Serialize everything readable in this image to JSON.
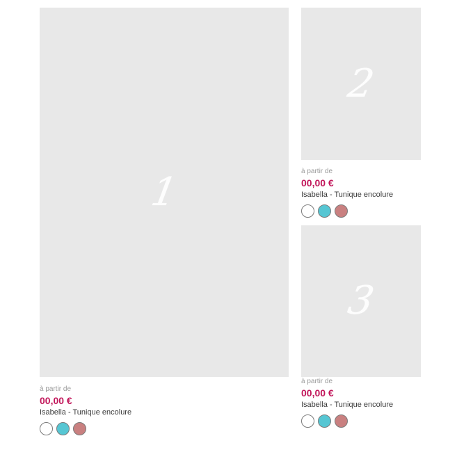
{
  "products": [
    {
      "number": "1",
      "price_prefix": "à partir de",
      "price": "00,00 €",
      "name": "Isabella - Tunique encolure",
      "swatches": [
        "#ffffff",
        "#56c6d3",
        "#c98080"
      ]
    },
    {
      "number": "2",
      "price_prefix": "à partir de",
      "price": "00,00 €",
      "name": "Isabella - Tunique encolure",
      "swatches": [
        "#ffffff",
        "#56c6d3",
        "#c98080"
      ]
    },
    {
      "number": "3",
      "price_prefix": "à partir de",
      "price": "00,00 €",
      "name": "Isabella - Tunique encolure",
      "swatches": [
        "#ffffff",
        "#56c6d3",
        "#c98080"
      ]
    }
  ],
  "colors": {
    "price": "#c2185b",
    "placeholder": "#e8e8e8"
  }
}
